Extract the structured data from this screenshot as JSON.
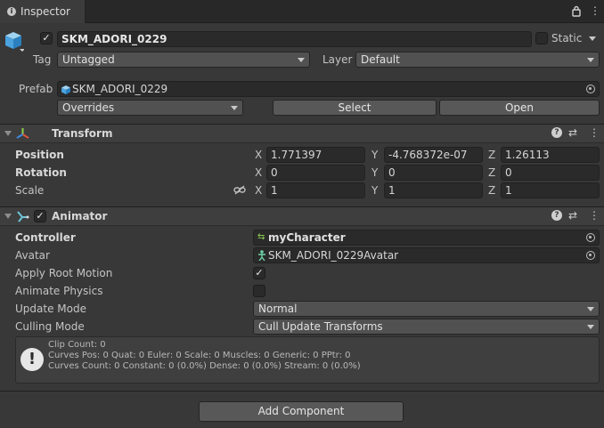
{
  "tab": {
    "label": "Inspector"
  },
  "object": {
    "name": "SKM_ADORI_0229",
    "static_label": "Static",
    "tag_label": "Tag",
    "tag_value": "Untagged",
    "layer_label": "Layer",
    "layer_value": "Default",
    "prefab_label": "Prefab",
    "prefab_value": "SKM_ADORI_0229",
    "overrides_value": "Overrides",
    "select_label": "Select",
    "open_label": "Open"
  },
  "transform": {
    "title": "Transform",
    "position": {
      "label": "Position",
      "x": "1.771397",
      "y": "-4.768372e-07",
      "z": "1.26113"
    },
    "rotation": {
      "label": "Rotation",
      "x": "0",
      "y": "0",
      "z": "0"
    },
    "scale": {
      "label": "Scale",
      "x": "1",
      "y": "1",
      "z": "1"
    },
    "axes": {
      "x": "X",
      "y": "Y",
      "z": "Z"
    }
  },
  "animator": {
    "title": "Animator",
    "controller_label": "Controller",
    "controller_value": "myCharacter",
    "avatar_label": "Avatar",
    "avatar_value": "SKM_ADORI_0229Avatar",
    "apply_root_motion_label": "Apply Root Motion",
    "animate_physics_label": "Animate Physics",
    "update_mode_label": "Update Mode",
    "update_mode_value": "Normal",
    "culling_mode_label": "Culling Mode",
    "culling_mode_value": "Cull Update Transforms",
    "info_lines": [
      "Clip Count: 0",
      "Curves Pos: 0 Quat: 0 Euler: 0 Scale: 0 Muscles: 0 Generic: 0 PPtr: 0",
      "Curves Count: 0 Constant: 0 (0.0%) Dense: 0 (0.0%) Stream: 0 (0.0%)"
    ]
  },
  "add_component_label": "Add Component",
  "colors": {
    "background": "#383838",
    "header": "#3e3e3e",
    "field": "#2a2a2a",
    "button": "#585858"
  }
}
